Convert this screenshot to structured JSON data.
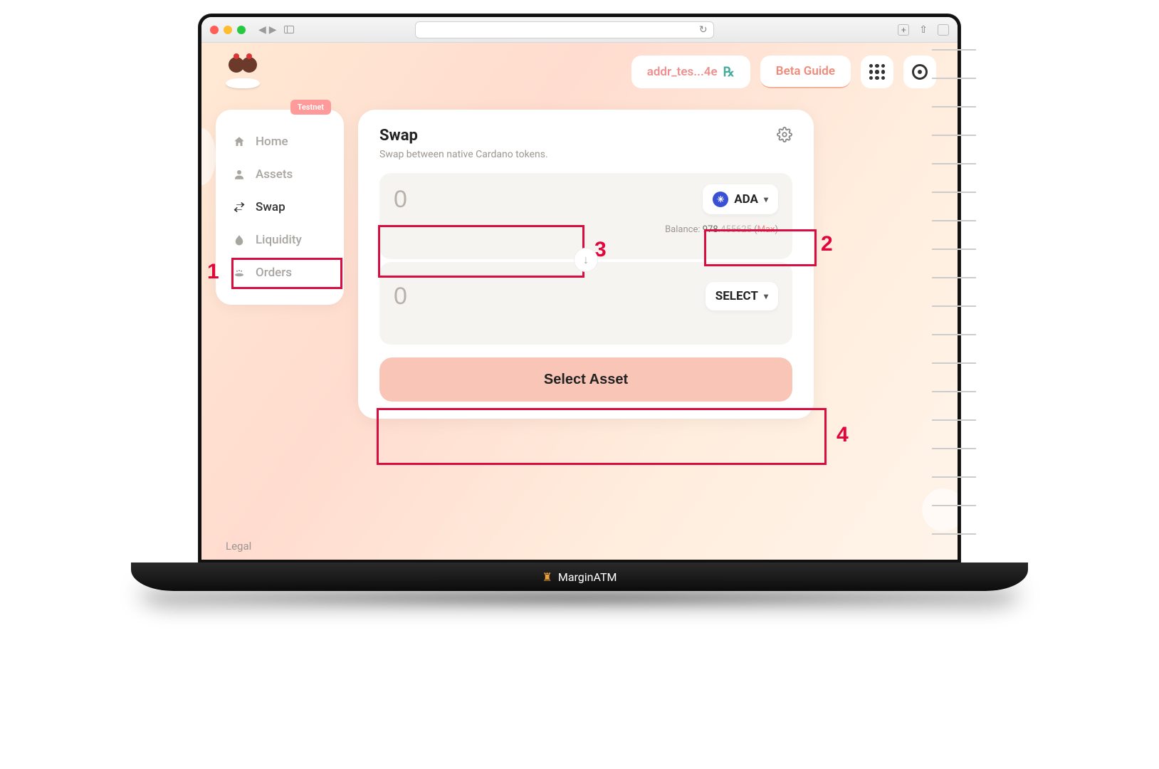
{
  "header": {
    "address": "addr_tes...4e",
    "beta_guide": "Beta Guide"
  },
  "sidebar": {
    "badge": "Testnet",
    "items": [
      {
        "label": "Home"
      },
      {
        "label": "Assets"
      },
      {
        "label": "Swap"
      },
      {
        "label": "Liquidity"
      },
      {
        "label": "Orders"
      }
    ]
  },
  "swap": {
    "title": "Swap",
    "subtitle": "Swap between native Cardano tokens.",
    "from": {
      "amount": "0",
      "token": "ADA",
      "balance_label": "Balance: ",
      "balance_int": "978",
      "balance_frac": ".455625",
      "max": "Max"
    },
    "to": {
      "amount": "0",
      "select": "SELECT"
    },
    "cta": "Select Asset"
  },
  "footer": {
    "legal": "Legal"
  },
  "annotations": {
    "n1": "1",
    "n2": "2",
    "n3": "3",
    "n4": "4"
  },
  "brand": {
    "name": "MarginATM"
  }
}
